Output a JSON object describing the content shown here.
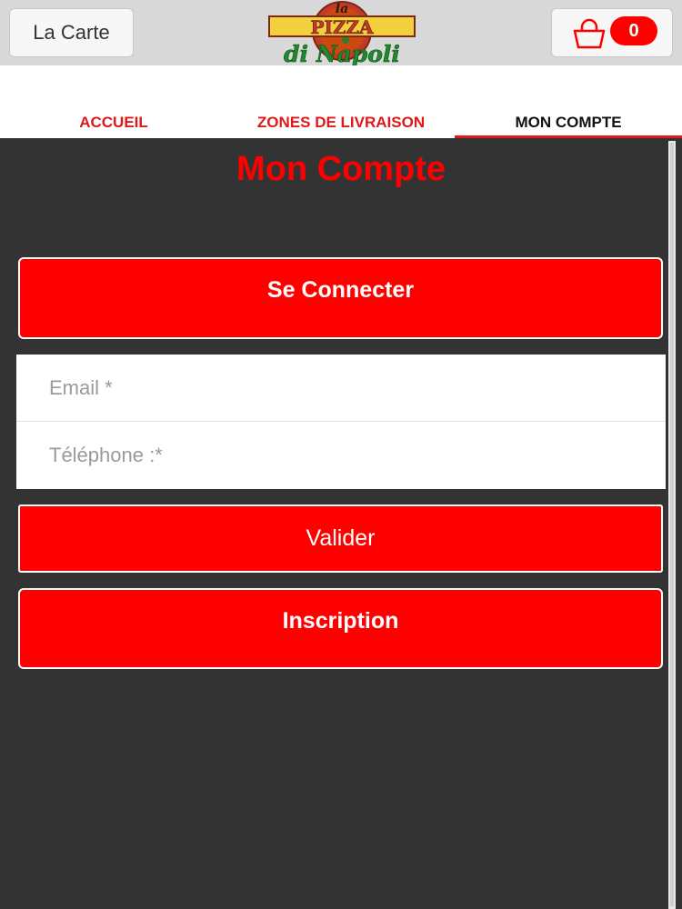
{
  "header": {
    "carte_label": "La Carte",
    "cart_count": "0",
    "logo_top": "la",
    "logo_mid": "PIZZA",
    "logo_bottom": "di Napoli"
  },
  "nav": {
    "items": [
      {
        "label": "ACCUEIL"
      },
      {
        "label": "ZONES DE LIVRAISON"
      },
      {
        "label": "MON COMPTE"
      }
    ]
  },
  "page": {
    "title": "Mon Compte",
    "connect_label": "Se Connecter",
    "email_placeholder": "Email *",
    "phone_placeholder": "Téléphone :*",
    "validate_label": "Valider",
    "signup_label": "Inscription"
  },
  "colors": {
    "accent": "#ff0000",
    "background": "#333333",
    "header": "#d9d9d9"
  }
}
